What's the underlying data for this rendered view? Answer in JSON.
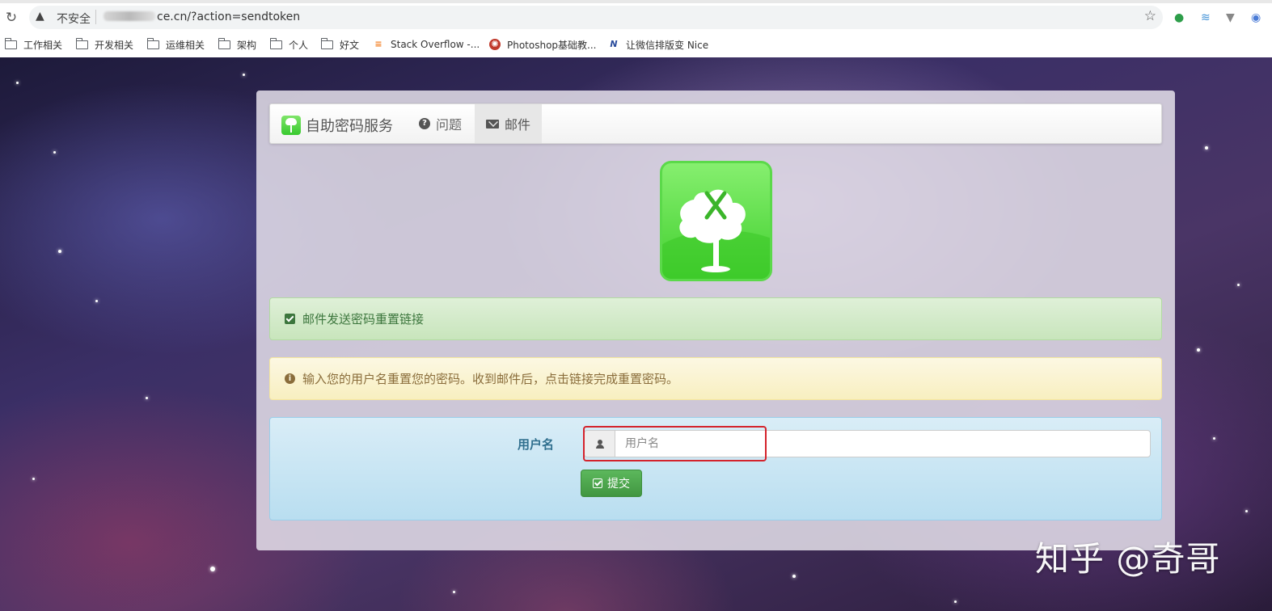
{
  "browser": {
    "security_label": "不安全",
    "url_suffix": "ce.cn/?action=sendtoken",
    "bookmarks": [
      {
        "label": "工作相关",
        "icon": "folder-icon"
      },
      {
        "label": "开发相关",
        "icon": "folder-icon"
      },
      {
        "label": "运维相关",
        "icon": "folder-icon"
      },
      {
        "label": "架构",
        "icon": "folder-icon"
      },
      {
        "label": "个人",
        "icon": "folder-icon"
      },
      {
        "label": "好文",
        "icon": "folder-icon"
      },
      {
        "label": "Stack Overflow -...",
        "icon": "stackoverflow-icon"
      },
      {
        "label": "Photoshop基础教...",
        "icon": "photoshop-site-icon"
      },
      {
        "label": "让微信排版变 Nice",
        "icon": "nice-icon"
      }
    ]
  },
  "navbar": {
    "brand": "自助密码服务",
    "items": [
      {
        "label": "问题",
        "icon": "question-circle-icon",
        "active": false
      },
      {
        "label": "邮件",
        "icon": "envelope-icon",
        "active": true
      }
    ]
  },
  "alerts": {
    "success": "邮件发送密码重置链接",
    "info": "输入您的用户名重置您的密码。收到邮件后，点击链接完成重置密码。"
  },
  "form": {
    "username_label": "用户名",
    "username_placeholder": "用户名",
    "submit_label": "提交"
  },
  "watermark": "知乎 @奇哥",
  "colors": {
    "success_text": "#3c763d",
    "warning_text": "#8a6d3b",
    "info_text": "#31708f",
    "submit_green": "#5cb85c",
    "highlight_red": "#d4232c"
  }
}
